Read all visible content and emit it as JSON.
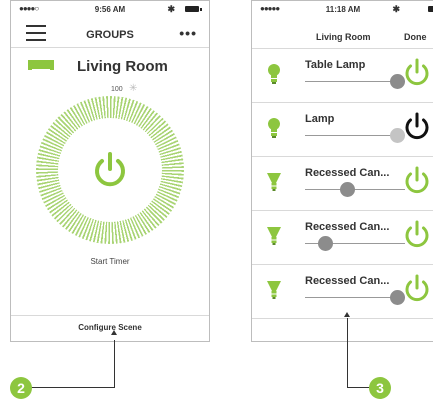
{
  "phone1": {
    "status": {
      "signal": "●●●●○",
      "time": "9:56 AM",
      "bluetooth": "✱"
    },
    "header": {
      "title": "GROUPS",
      "more": "•••"
    },
    "room": {
      "name": "Living Room",
      "brightness": "100"
    },
    "timer_label": "Start Timer",
    "configure_label": "Configure Scene"
  },
  "phone2": {
    "status": {
      "signal": "●●●●●",
      "time": "11:18 AM",
      "bluetooth": "✱"
    },
    "header": {
      "title": "Living Room",
      "done": "Done"
    },
    "rows": [
      {
        "name": "Table Lamp",
        "level": 0.92,
        "on": true,
        "bulb": "bulb-icon"
      },
      {
        "name": "Lamp",
        "level": 0.92,
        "on": false,
        "bulb": "bulb-icon"
      },
      {
        "name": "Recessed Can...",
        "level": 0.42,
        "on": true,
        "bulb": "recessed-can-icon"
      },
      {
        "name": "Recessed Can...",
        "level": 0.2,
        "on": true,
        "bulb": "recessed-can-icon"
      },
      {
        "name": "Recessed Can...",
        "level": 0.92,
        "on": true,
        "bulb": "recessed-can-icon"
      }
    ]
  },
  "callouts": [
    "2",
    "3"
  ],
  "colors": {
    "accent": "#8dc63f",
    "off": "#111111",
    "knob": "#8c8c8c"
  }
}
